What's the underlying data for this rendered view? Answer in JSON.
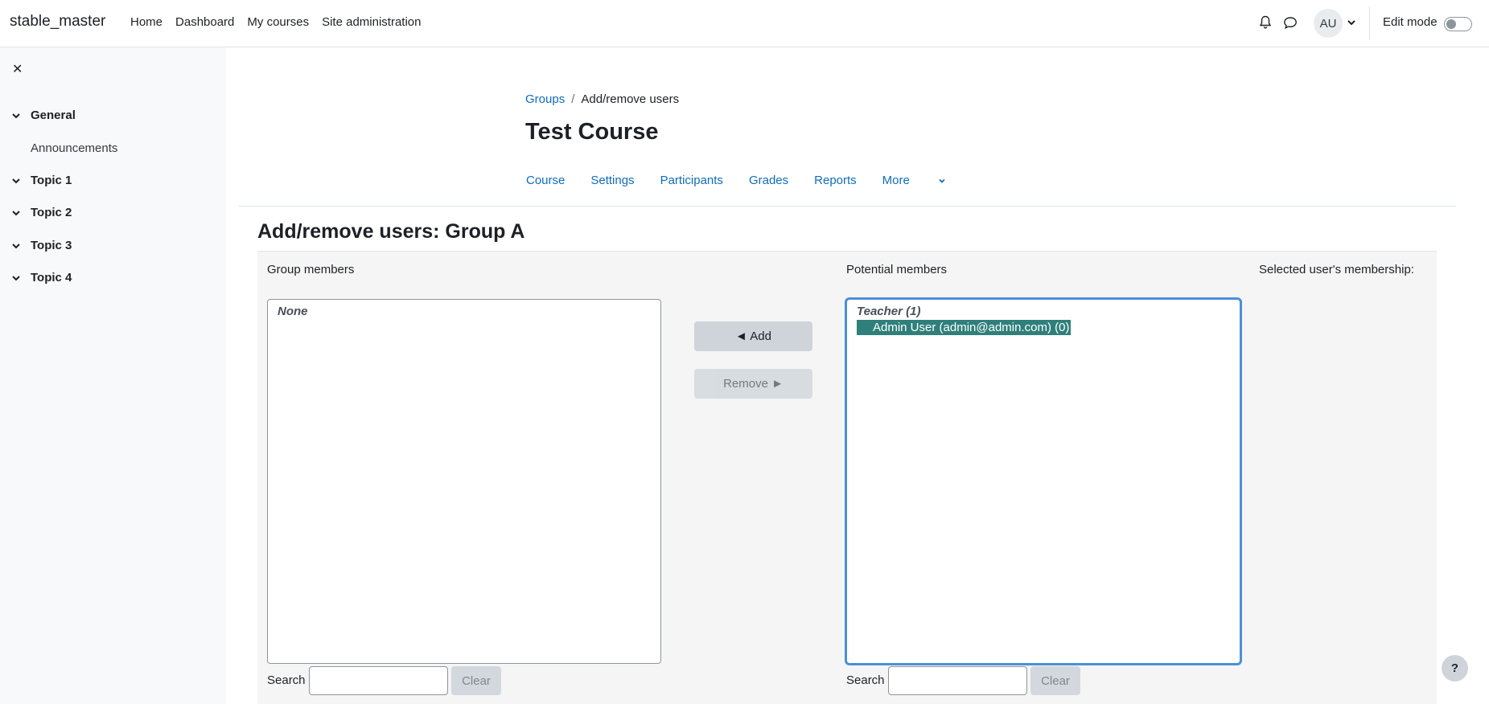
{
  "navbar": {
    "brand": "stable_master",
    "links": [
      "Home",
      "Dashboard",
      "My courses",
      "Site administration"
    ],
    "user_initials": "AU",
    "edit_mode_label": "Edit mode"
  },
  "drawer": {
    "sections": [
      {
        "label": "General"
      },
      {
        "label": "Topic 1"
      },
      {
        "label": "Topic 2"
      },
      {
        "label": "Topic 3"
      },
      {
        "label": "Topic 4"
      }
    ],
    "general_item": "Announcements"
  },
  "breadcrumb": {
    "parent": "Groups",
    "separator": "/",
    "current": "Add/remove users"
  },
  "page_title": "Test Course",
  "secondary_nav": [
    "Course",
    "Settings",
    "Participants",
    "Grades",
    "Reports",
    "More"
  ],
  "section_title": "Add/remove users: Group A",
  "group_members": {
    "label": "Group members",
    "empty_text": "None",
    "search_label": "Search",
    "clear_label": "Clear"
  },
  "actions": {
    "add_label": "◄ Add",
    "remove_label": "Remove ►"
  },
  "potential_members": {
    "label": "Potential members",
    "group_label": "Teacher (1)",
    "selected_user": "Admin User (admin@admin.com) (0)",
    "search_label": "Search",
    "clear_label": "Clear"
  },
  "membership_label": "Selected user's membership:",
  "help_label": "?",
  "colors": {
    "link": "#0f6cbf",
    "selected_option": "#2f7f7a",
    "focus_border": "#4a90d9"
  }
}
